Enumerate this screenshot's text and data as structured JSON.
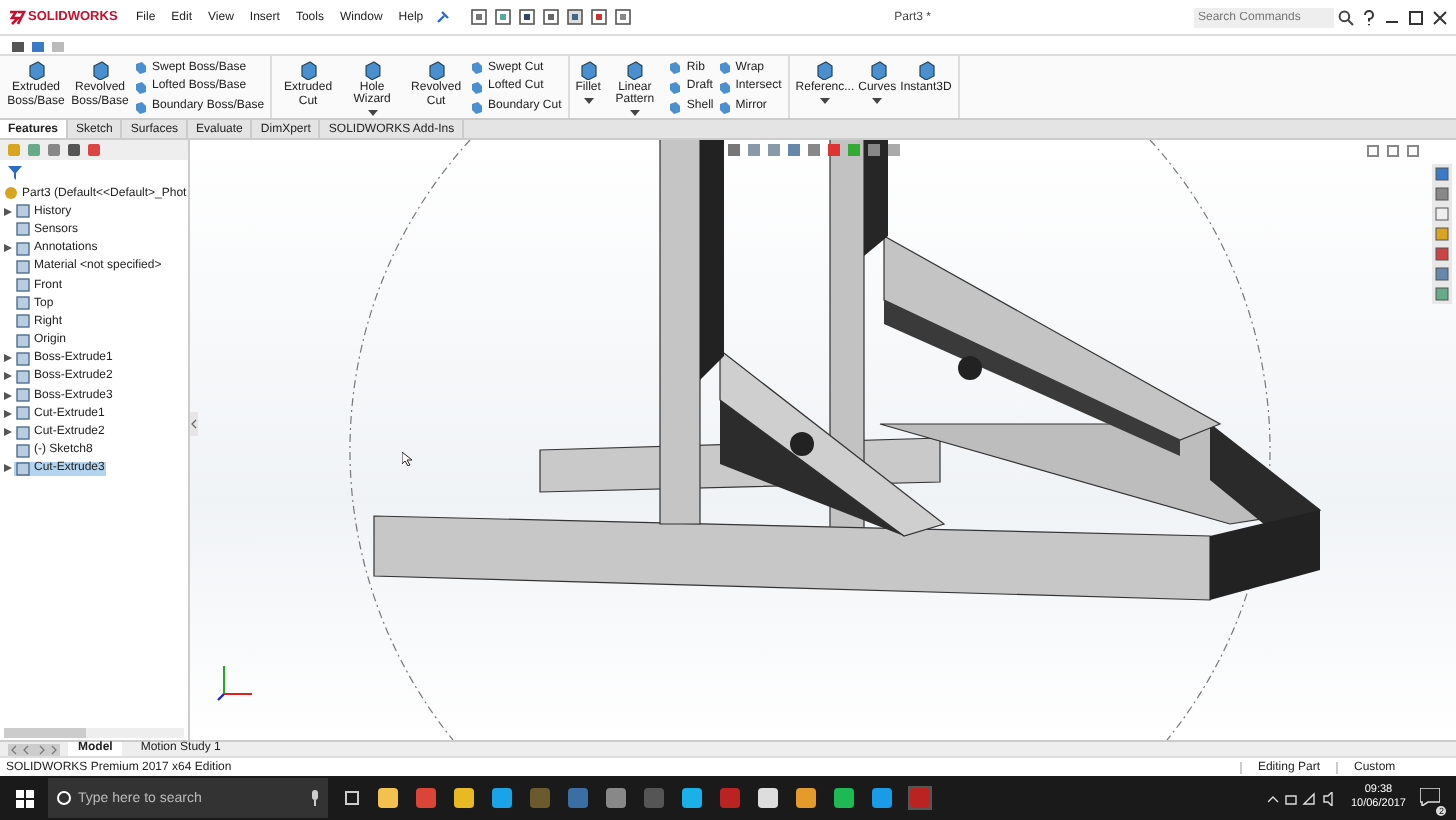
{
  "app": {
    "logo": "SOLIDWORKS",
    "title": "Part3 *"
  },
  "menu": [
    "File",
    "Edit",
    "View",
    "Insert",
    "Tools",
    "Window",
    "Help"
  ],
  "search": {
    "placeholder": "Search Commands"
  },
  "ribbon_groups": [
    {
      "tools": [
        {
          "kind": "large",
          "label": "Extruded Boss/Base",
          "dropdown": false
        },
        {
          "kind": "large",
          "label": "Revolved Boss/Base",
          "dropdown": false
        },
        {
          "kind": "stack",
          "items": [
            "Swept Boss/Base",
            "Lofted Boss/Base",
            "Boundary Boss/Base"
          ]
        }
      ]
    },
    {
      "tools": [
        {
          "kind": "large",
          "label": "Extruded Cut",
          "dropdown": false
        },
        {
          "kind": "large",
          "label": "Hole Wizard",
          "dropdown": true
        },
        {
          "kind": "large",
          "label": "Revolved Cut",
          "dropdown": false
        },
        {
          "kind": "stack",
          "items": [
            "Swept Cut",
            "Lofted Cut",
            "Boundary Cut"
          ]
        }
      ]
    },
    {
      "tools": [
        {
          "kind": "large",
          "label": "Fillet",
          "dropdown": true
        },
        {
          "kind": "large",
          "label": "Linear Pattern",
          "dropdown": true
        },
        {
          "kind": "stack",
          "items": [
            "Rib",
            "Draft",
            "Shell"
          ]
        },
        {
          "kind": "stack",
          "items": [
            "Wrap",
            "Intersect",
            "Mirror"
          ]
        }
      ]
    },
    {
      "tools": [
        {
          "kind": "large",
          "label": "Referenc...",
          "dropdown": true
        },
        {
          "kind": "large",
          "label": "Curves",
          "dropdown": true
        },
        {
          "kind": "large",
          "label": "Instant3D",
          "dropdown": false
        }
      ]
    }
  ],
  "command_tabs": [
    {
      "label": "Features",
      "selected": true
    },
    {
      "label": "Sketch",
      "selected": false
    },
    {
      "label": "Surfaces",
      "selected": false
    },
    {
      "label": "Evaluate",
      "selected": false
    },
    {
      "label": "DimXpert",
      "selected": false
    },
    {
      "label": "SOLIDWORKS Add-Ins",
      "selected": false
    }
  ],
  "tree": {
    "root": "Part3  (Default<<Default>_Phot",
    "items": [
      {
        "label": "History",
        "expandable": true,
        "selected": false
      },
      {
        "label": "Sensors",
        "expandable": false,
        "selected": false
      },
      {
        "label": "Annotations",
        "expandable": true,
        "selected": false
      },
      {
        "label": "Material <not specified>",
        "expandable": false,
        "selected": false
      },
      {
        "label": "Front",
        "expandable": false,
        "selected": false
      },
      {
        "label": "Top",
        "expandable": false,
        "selected": false
      },
      {
        "label": "Right",
        "expandable": false,
        "selected": false
      },
      {
        "label": "Origin",
        "expandable": false,
        "selected": false
      },
      {
        "label": "Boss-Extrude1",
        "expandable": true,
        "selected": false
      },
      {
        "label": "Boss-Extrude2",
        "expandable": true,
        "selected": false
      },
      {
        "label": "Boss-Extrude3",
        "expandable": true,
        "selected": false
      },
      {
        "label": "Cut-Extrude1",
        "expandable": true,
        "selected": false
      },
      {
        "label": "Cut-Extrude2",
        "expandable": true,
        "selected": false
      },
      {
        "label": "(-) Sketch8",
        "expandable": false,
        "selected": false
      },
      {
        "label": "Cut-Extrude3",
        "expandable": true,
        "selected": true
      }
    ]
  },
  "bottom_tabs": [
    {
      "label": "Model",
      "selected": true
    },
    {
      "label": "Motion Study 1",
      "selected": false
    }
  ],
  "status_bar": {
    "edition": "SOLIDWORKS Premium 2017 x64 Edition",
    "mode": "Editing Part",
    "units": "Custom"
  },
  "taskbar": {
    "search_placeholder": "Type here to search",
    "time": "09:38",
    "date": "10/06/2017",
    "notifications": "2"
  }
}
